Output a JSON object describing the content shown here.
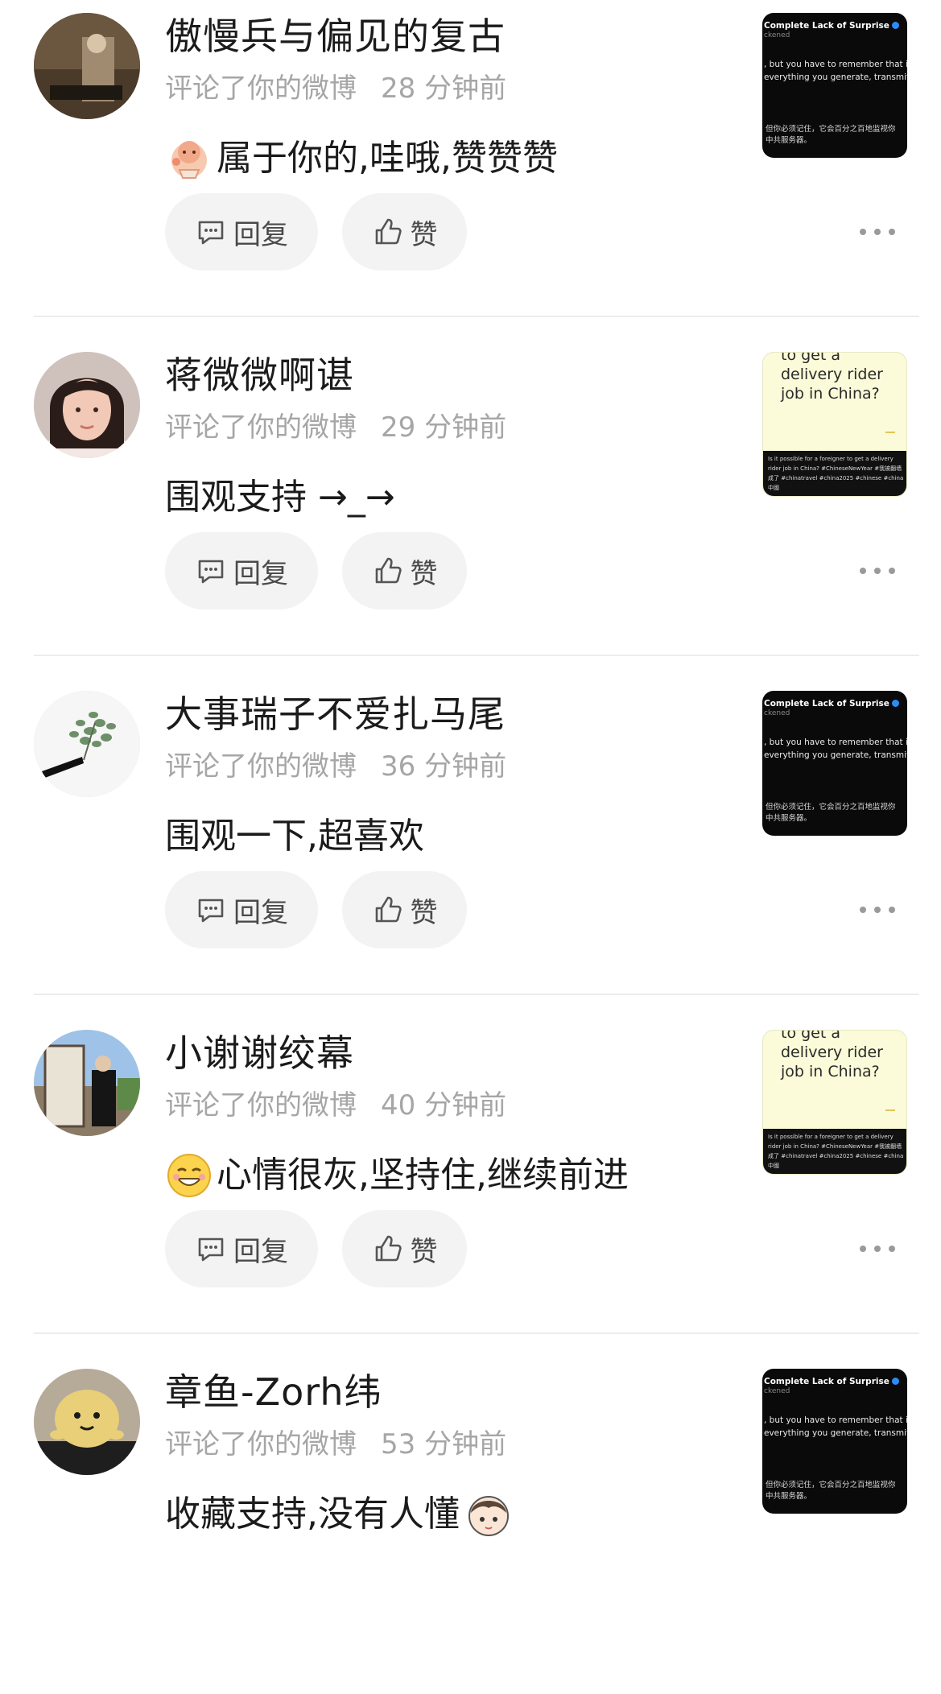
{
  "actions": {
    "reply_label": "回复",
    "like_label": "赞"
  },
  "thumb_dark": {
    "title": "Complete Lack of Surprise",
    "handle": "ckened",
    "line1": ", but you have to remember that it i",
    "line2": "everything you generate, transmitti",
    "cn1": "但你必须记住，它会百分之百地监视你",
    "cn2": "中共服务器。"
  },
  "thumb_light": {
    "line0": "to get a",
    "line1": "delivery rider",
    "line2": "job in China?",
    "caption": "Is it possible for a foreigner to get a delivery rider job in China? #ChineseNewYear #我被翻墙成了 #chinatravel #china2025 #chinese #china中國"
  },
  "comments": [
    {
      "name": "傲慢兵与偏见的复古",
      "action": "评论了你的微博",
      "time": "28 分钟前",
      "text": "属于你的,哇哦,赞赞赞",
      "emoji": "bowing-emoji",
      "thumb": "dark"
    },
    {
      "name": "蒋微微啊谌",
      "action": "评论了你的微博",
      "time": "29 分钟前",
      "text": "围观支持 →_→",
      "emoji": "",
      "thumb": "light"
    },
    {
      "name": "大事瑞子不爱扎马尾",
      "action": "评论了你的微博",
      "time": "36 分钟前",
      "text": "围观一下,超喜欢",
      "emoji": "",
      "thumb": "dark"
    },
    {
      "name": "小谢谢绞幕",
      "action": "评论了你的微博",
      "time": "40 分钟前",
      "text": "心情很灰,坚持住,继续前进",
      "emoji": "grin-emoji",
      "thumb": "light"
    },
    {
      "name": "章鱼-Zorh纬",
      "action": "评论了你的微博",
      "time": "53 分钟前",
      "text": "收藏支持,没有人懂",
      "emoji": "cartoon-face-emoji",
      "thumb": "dark"
    }
  ]
}
